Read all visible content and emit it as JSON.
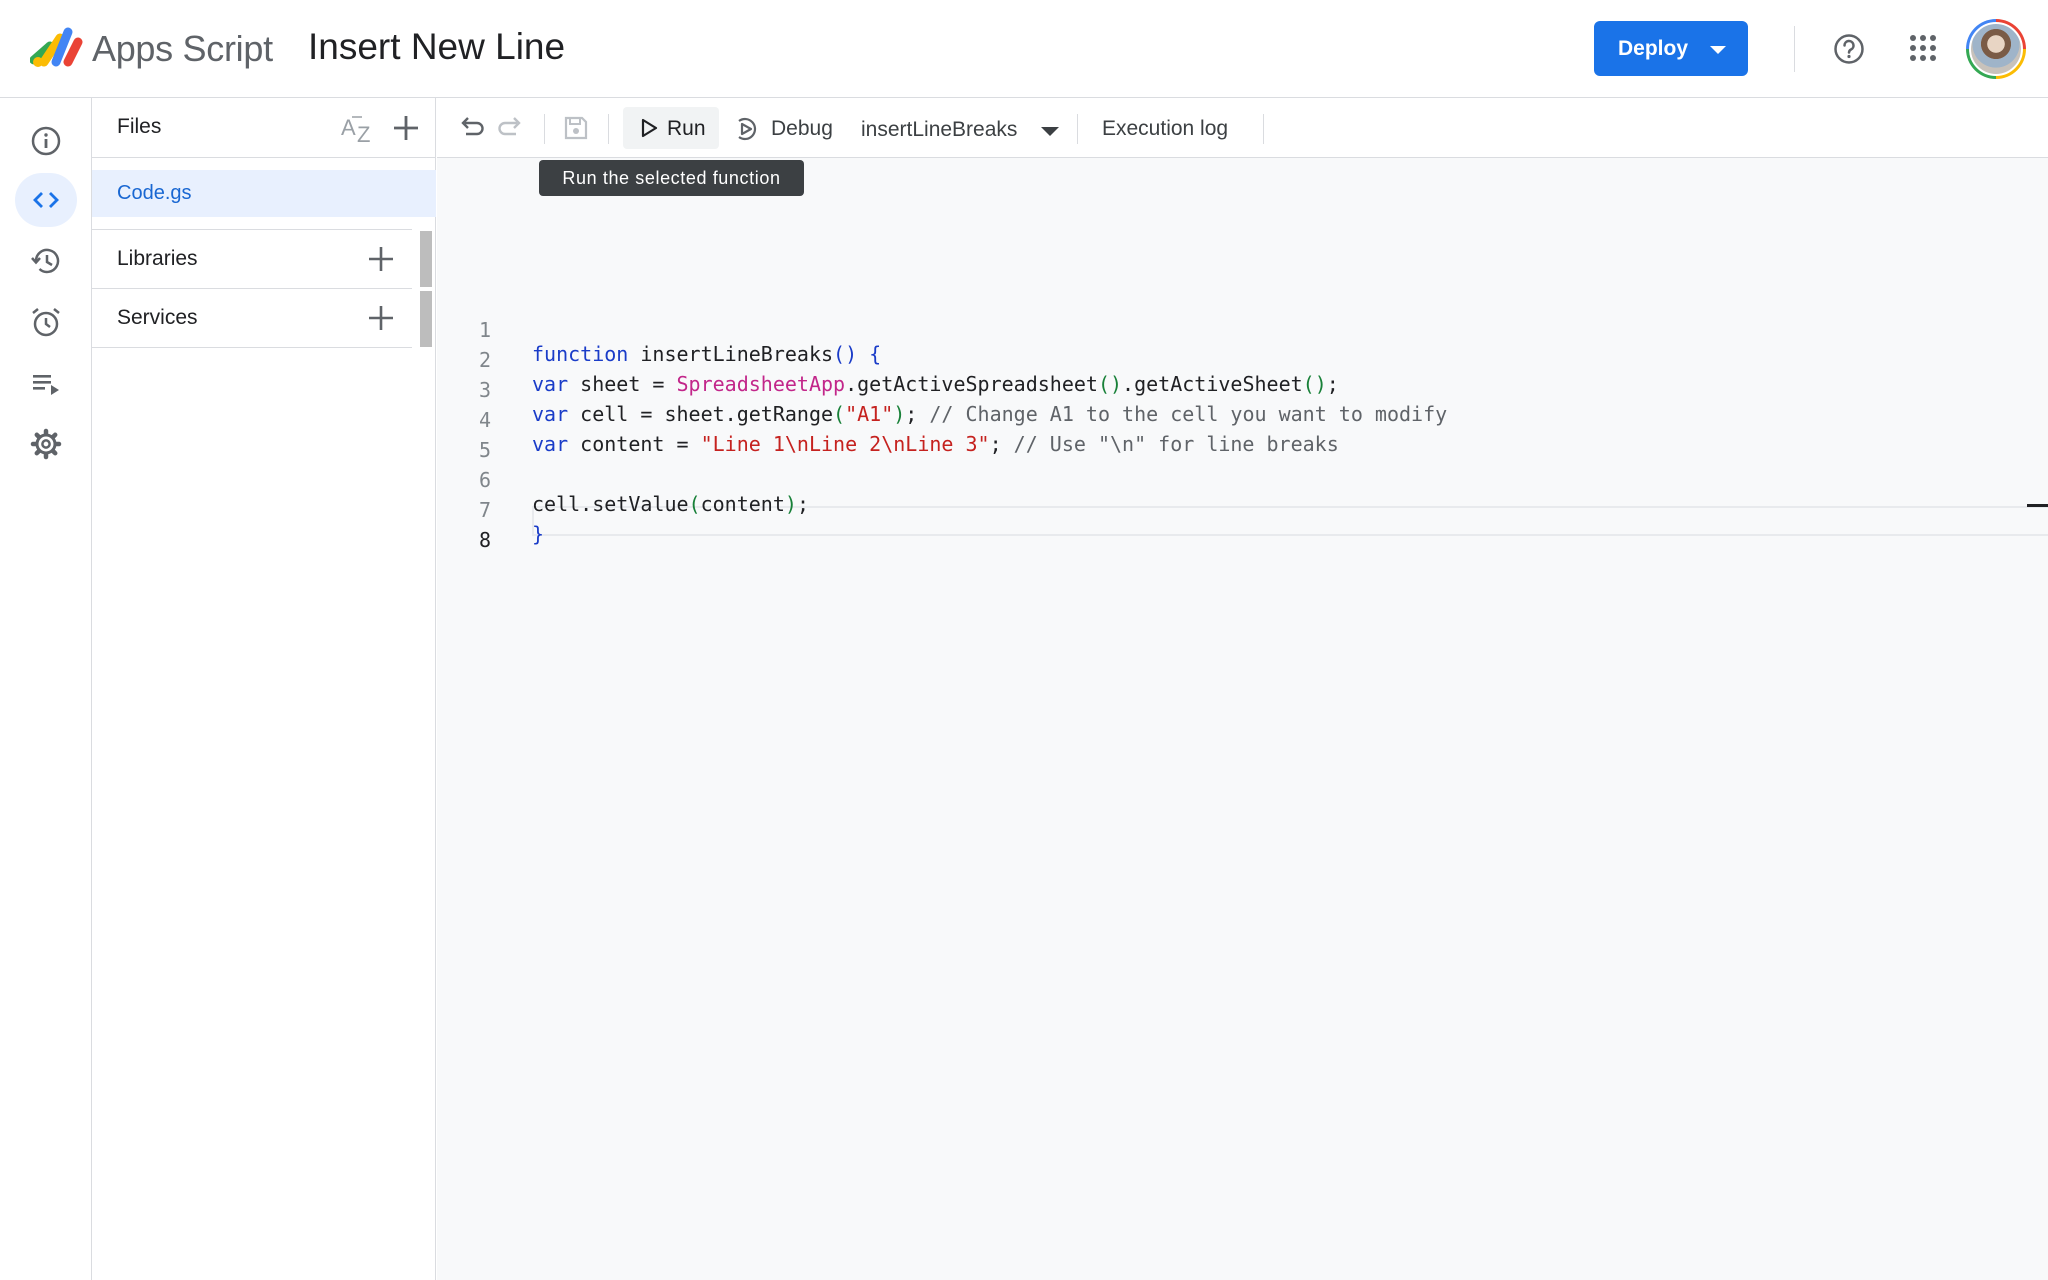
{
  "header": {
    "app_name": "Apps Script",
    "project_title": "Insert New Line",
    "deploy_label": "Deploy"
  },
  "rail": {
    "items": [
      {
        "name": "overview-icon",
        "active": false
      },
      {
        "name": "editor-icon",
        "active": true
      },
      {
        "name": "history-icon",
        "active": false
      },
      {
        "name": "triggers-icon",
        "active": false
      },
      {
        "name": "executions-icon",
        "active": false
      },
      {
        "name": "settings-icon",
        "active": false
      }
    ]
  },
  "files": {
    "title": "Files",
    "items": [
      {
        "label": "Code.gs",
        "selected": true
      }
    ],
    "libraries_label": "Libraries",
    "services_label": "Services"
  },
  "toolbar": {
    "run_label": "Run",
    "debug_label": "Debug",
    "function_selected": "insertLineBreaks",
    "execution_log_label": "Execution log",
    "run_tooltip": "Run the selected function"
  },
  "editor": {
    "active_line": 8,
    "lines": [
      {
        "n": "1",
        "text": "function insertLineBreaks() {"
      },
      {
        "n": "2",
        "text": "var sheet = SpreadsheetApp.getActiveSpreadsheet().getActiveSheet();"
      },
      {
        "n": "3",
        "text": "var cell = sheet.getRange(\"A1\"); // Change A1 to the cell you want to modify"
      },
      {
        "n": "4",
        "text": "var content = \"Line 1\\nLine 2\\nLine 3\"; // Use \"\\n\" for line breaks"
      },
      {
        "n": "5",
        "text": ""
      },
      {
        "n": "6",
        "text": "cell.setValue(content);"
      },
      {
        "n": "7",
        "text": "}"
      },
      {
        "n": "8",
        "text": ""
      }
    ]
  },
  "colors": {
    "accent": "#1a73e8",
    "keyword": "#1a3cc8",
    "class": "#c2268a",
    "string": "#c5221f",
    "comment": "#5f6368"
  }
}
